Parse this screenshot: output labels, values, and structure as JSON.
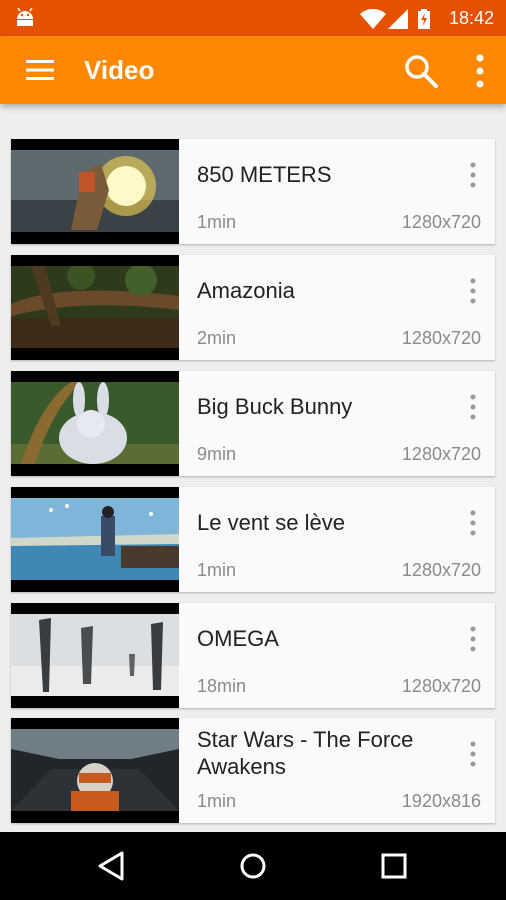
{
  "status_bar": {
    "time": "18:42",
    "icons": [
      "android-icon",
      "wifi-icon",
      "signal-icon",
      "battery-charging-icon"
    ]
  },
  "toolbar": {
    "title": "Video",
    "icons": [
      "menu-icon",
      "search-icon",
      "more-vert-icon"
    ]
  },
  "colors": {
    "accent": "#ff8800",
    "status_bar": "#e65100"
  },
  "videos": [
    {
      "title": "850 METERS",
      "duration": "1min",
      "resolution": "1280x720"
    },
    {
      "title": "Amazonia",
      "duration": "2min",
      "resolution": "1280x720"
    },
    {
      "title": "Big Buck Bunny",
      "duration": "9min",
      "resolution": "1280x720"
    },
    {
      "title": "Le vent se lève",
      "duration": "1min",
      "resolution": "1280x720"
    },
    {
      "title": "OMEGA",
      "duration": "18min",
      "resolution": "1280x720"
    },
    {
      "title": "Star Wars - The Force Awakens",
      "duration": "1min",
      "resolution": "1920x816"
    }
  ],
  "nav_bar": {
    "icons": [
      "back-icon",
      "home-icon",
      "recents-icon"
    ]
  }
}
